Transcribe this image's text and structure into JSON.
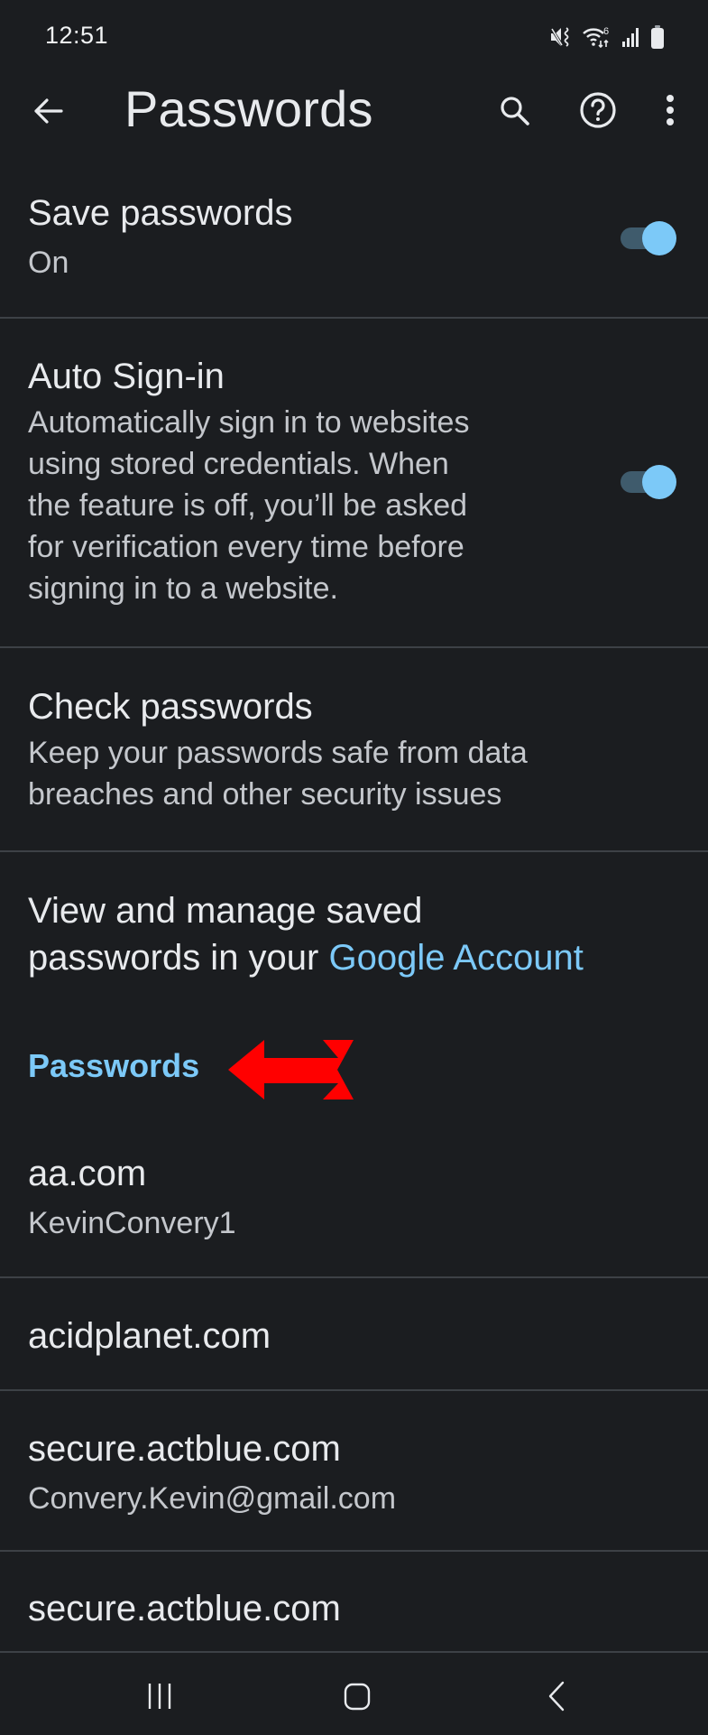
{
  "status_bar": {
    "time": "12:51",
    "icons": [
      "mute-vibrate-icon",
      "wifi-6-icon",
      "signal-icon",
      "battery-icon"
    ],
    "wifi_badge": "6"
  },
  "toolbar": {
    "back_icon": "arrow-left-icon",
    "title": "Passwords",
    "actions": [
      "search-icon",
      "help-icon",
      "more-vert-icon"
    ]
  },
  "settings": {
    "save_passwords": {
      "title": "Save passwords",
      "subtitle": "On",
      "enabled": true
    },
    "auto_signin": {
      "title": "Auto Sign-in",
      "description_lines": [
        "Automatically sign in to websites",
        "using stored credentials. When",
        "the feature is off, you’ll be asked",
        "for verification every time before",
        "signing in to a website."
      ],
      "enabled": true
    },
    "check_passwords": {
      "title": "Check passwords",
      "description_lines": [
        "Keep your passwords safe from data",
        "breaches and other security issues"
      ]
    },
    "manage": {
      "line1": "View and manage saved",
      "line2_prefix": "passwords in your ",
      "link": "Google Account"
    }
  },
  "passwords_section": {
    "header": "Passwords",
    "annotation": "red-arrow-pointing-left",
    "entries": [
      {
        "site": "aa.com",
        "username": "KevinConvery1"
      },
      {
        "site": "acidplanet.com",
        "username": ""
      },
      {
        "site": "secure.actblue.com",
        "username": "Convery.Kevin@gmail.com"
      },
      {
        "site": "secure.actblue.com",
        "username": ""
      }
    ]
  },
  "nav_bar": {
    "buttons": [
      "recent-apps",
      "home",
      "back"
    ]
  },
  "colors": {
    "background": "#1b1d20",
    "text_primary": "#e8eaed",
    "text_secondary": "#c4c7cc",
    "accent": "#7cc9f8",
    "toggle_track": "#3f5b6c",
    "divider": "#3d4146",
    "annotation": "#ff0000"
  }
}
